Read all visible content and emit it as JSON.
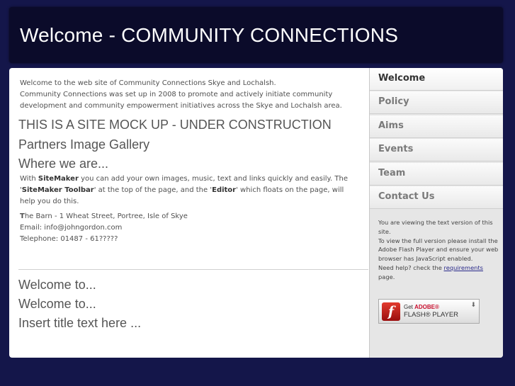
{
  "header": {
    "title": "Welcome - COMMUNITY CONNECTIONS"
  },
  "content": {
    "intro_line1": "Welcome to the web site of Community Connections Skye and Lochalsh.",
    "intro_line2": "Community Connections was set up in 2008 to promote and actively initiate community development and community empowerment initiatives across the Skye and Lochalsh area.",
    "mockup_heading": "THIS IS A SITE MOCK UP - UNDER CONSTRUCTION",
    "gallery_heading": "Partners Image Gallery",
    "where_heading": "Where we are...",
    "sitemaker": {
      "with": "With ",
      "sitemaker": "SiteMaker",
      "after_sitemaker": " you can add your own images, music, text and links quickly and easily. The '",
      "toolbar": "SiteMaker Toolbar",
      "after_toolbar": "' at the top of the page, and the '",
      "editor": "Editor",
      "after_editor": "' which floats on the page, will help you do this."
    },
    "address": {
      "first_letter": "T",
      "line1_rest": "he Barn - 1 Wheat Street, Portree, Isle of Skye",
      "email": "Email: info@johngordon.com",
      "telephone": "Telephone: 01487 - 61?????"
    },
    "welcome1": "Welcome to...",
    "welcome2": "Welcome to...",
    "insert_title": "Insert title text here ..."
  },
  "nav": {
    "items": [
      {
        "label": "Welcome",
        "active": true
      },
      {
        "label": "Policy"
      },
      {
        "label": "Aims"
      },
      {
        "label": "Events"
      },
      {
        "label": "Team"
      },
      {
        "label": "Contact Us"
      }
    ]
  },
  "notice": {
    "line1": "You are viewing the text version of this site.",
    "line2": "To view the full version please install the Adobe Flash Player and ensure your web browser has JavaScript enabled.",
    "line3_before": "Need help? check the ",
    "requirements_link": "requirements",
    "line3_after": " page."
  },
  "flash_badge": {
    "get": "Get ",
    "adobe": "ADOBE®",
    "product": "FLASH® PLAYER",
    "logo_glyph": "f",
    "arrow_glyph": "⬇"
  },
  "colors": {
    "page_background": "#14164a",
    "header_background": "#0b0b2a",
    "panel_background": "#ffffff",
    "sidebar_background": "#e6e6e6"
  }
}
